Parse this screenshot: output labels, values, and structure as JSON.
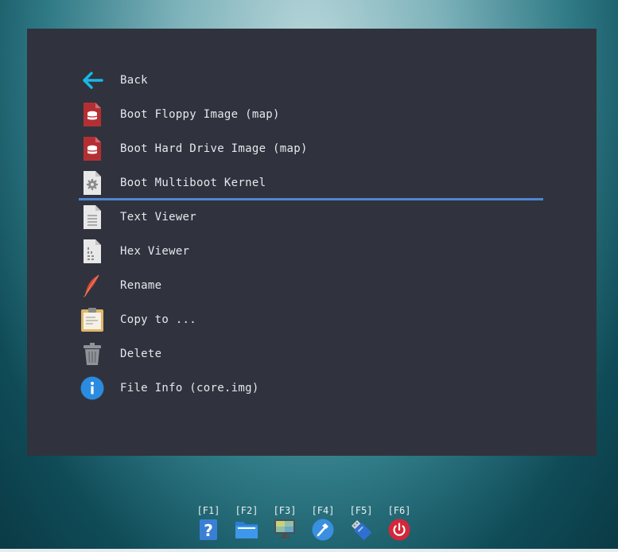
{
  "menu": {
    "items": [
      {
        "label": "Back",
        "icon": "back-arrow-icon"
      },
      {
        "label": "Boot Floppy Image (map)",
        "icon": "disk-image-icon"
      },
      {
        "label": "Boot Hard Drive Image (map)",
        "icon": "disk-image-icon"
      },
      {
        "label": "Boot Multiboot Kernel",
        "icon": "kernel-file-icon",
        "selected": true
      },
      {
        "label": "Text Viewer",
        "icon": "text-file-icon"
      },
      {
        "label": "Hex Viewer",
        "icon": "hex-file-icon"
      },
      {
        "label": "Rename",
        "icon": "feather-icon"
      },
      {
        "label": "Copy to ...",
        "icon": "clipboard-icon"
      },
      {
        "label": "Delete",
        "icon": "trash-icon"
      },
      {
        "label": "File Info (core.img)",
        "icon": "info-icon"
      }
    ]
  },
  "function_keys": [
    {
      "key": "[F1]",
      "icon": "help-icon"
    },
    {
      "key": "[F2]",
      "icon": "folder-icon"
    },
    {
      "key": "[F3]",
      "icon": "monitor-icon"
    },
    {
      "key": "[F4]",
      "icon": "hammer-icon"
    },
    {
      "key": "[F5]",
      "icon": "usb-drive-icon"
    },
    {
      "key": "[F6]",
      "icon": "power-icon"
    }
  ],
  "colors": {
    "panel": "#30333d",
    "selection_underline": "#4f86d2",
    "text": "#e6e8ec"
  }
}
